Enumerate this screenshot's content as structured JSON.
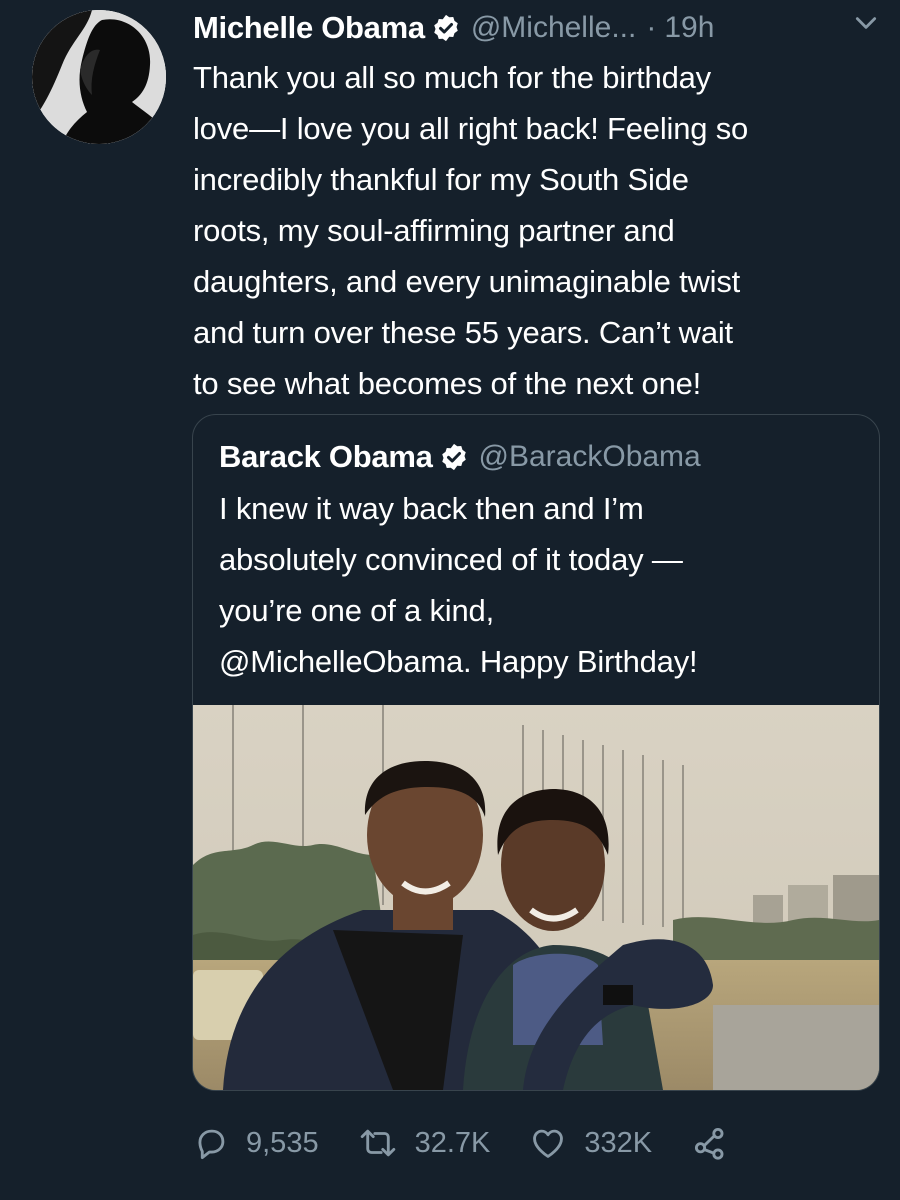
{
  "tweet": {
    "author_name": "Michelle Obama",
    "author_handle": "@Michelle...",
    "separator": "·",
    "timestamp": "19h",
    "text": "Thank you all so much for the birthday\nlove—I love you all right back! Feeling so\nincredibly thankful for my South Side\nroots, my soul-affirming partner and\ndaughters, and every unimaginable twist\nand turn over these 55 years. Can’t wait\nto see what becomes of the next one!"
  },
  "quoted_tweet": {
    "author_name": "Barack Obama",
    "author_handle": "@BarackObama",
    "text": "I knew it way back then and I’m\nabsolutely convinced of it today —\nyou’re one of a kind,\n@MichelleObama. Happy Birthday!"
  },
  "actions": {
    "replies": "9,535",
    "retweets": "32.7K",
    "likes": "332K"
  },
  "icons": {
    "verified": "verified-badge-icon",
    "caret": "chevron-down-icon",
    "reply": "reply-icon",
    "retweet": "retweet-icon",
    "like": "heart-icon",
    "share": "share-icon"
  },
  "colors": {
    "background": "#15202b",
    "secondary_text": "#8899a6",
    "border": "#38444d",
    "primary_text": "#ffffff"
  }
}
